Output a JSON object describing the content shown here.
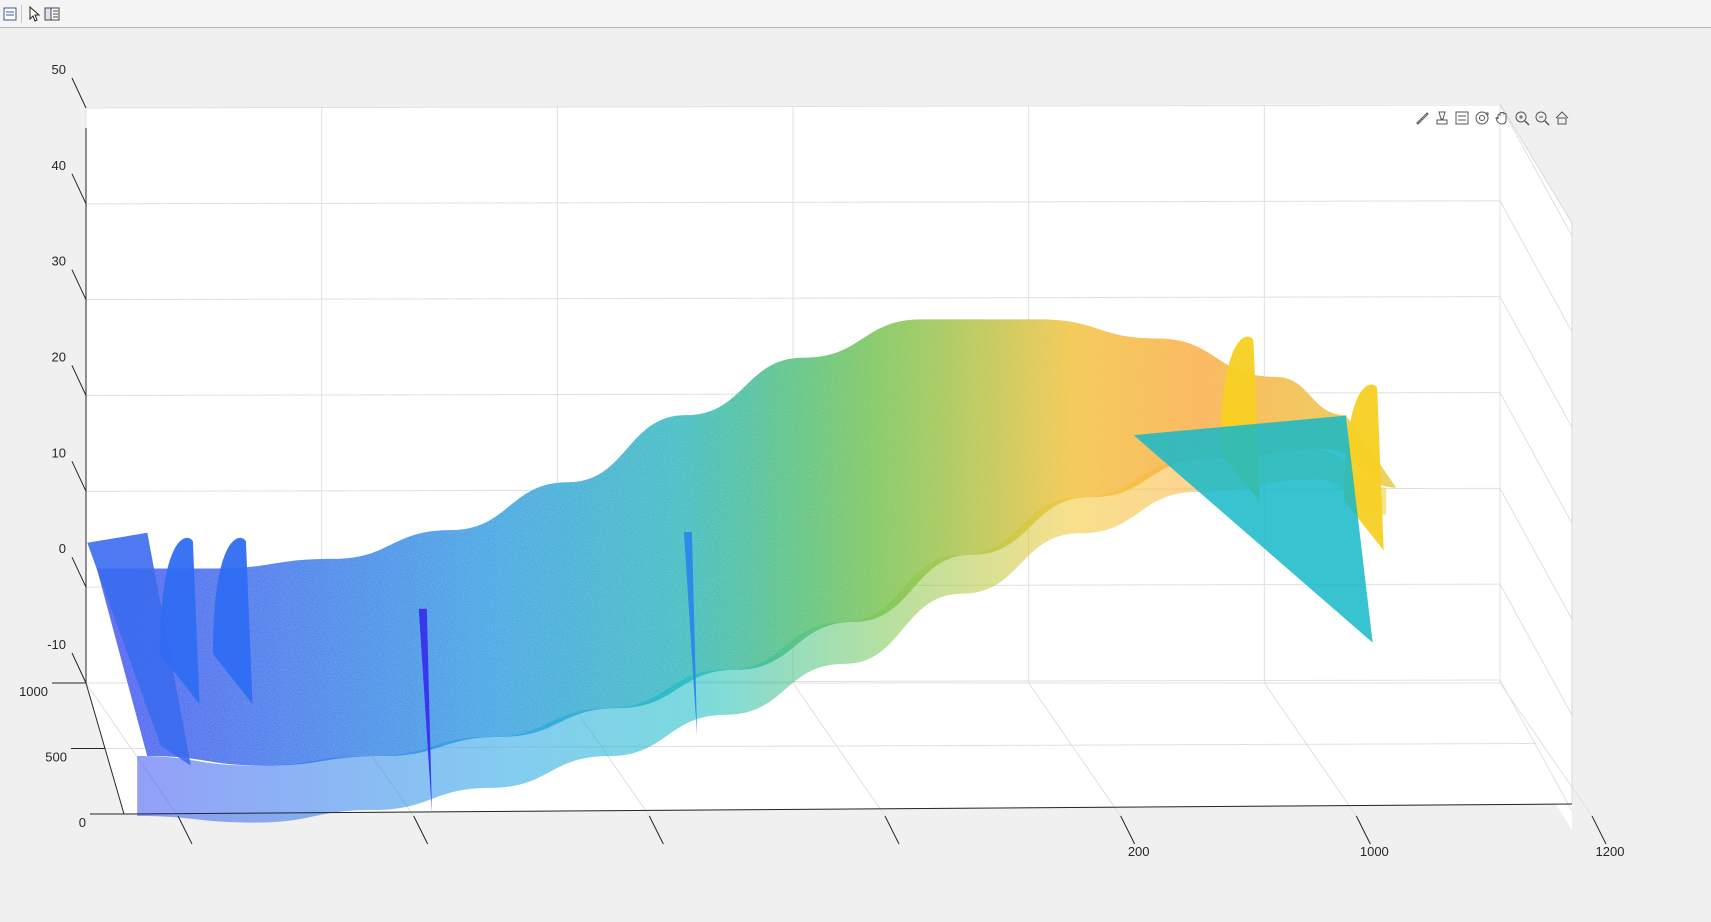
{
  "toolbar": {
    "buttons": [
      {
        "name": "property-inspector-icon"
      },
      {
        "name": "select-arrow-icon"
      },
      {
        "name": "plot-browser-icon"
      }
    ]
  },
  "axes_toolbar": {
    "buttons": [
      {
        "name": "brush-icon"
      },
      {
        "name": "data-tip-icon"
      },
      {
        "name": "legend-icon"
      },
      {
        "name": "rotate-3d-icon"
      },
      {
        "name": "pan-icon"
      },
      {
        "name": "zoom-in-icon"
      },
      {
        "name": "zoom-out-icon"
      },
      {
        "name": "restore-view-icon"
      }
    ]
  },
  "chart_data": {
    "type": "surface",
    "title": "",
    "xlabel": "",
    "ylabel": "",
    "zlabel": "",
    "colormap": "parula",
    "grid": true,
    "z_ticks": [
      "50",
      "40",
      "30",
      "20",
      "10",
      "0",
      "-10"
    ],
    "z_tick_values": [
      50,
      40,
      30,
      20,
      10,
      0,
      -10
    ],
    "zlim": [
      -10,
      50
    ],
    "y_ticks": [
      "1000",
      "500",
      "0"
    ],
    "y_tick_values": [
      1000,
      500,
      0
    ],
    "ylim": [
      0,
      1000
    ],
    "x_ticks": [
      "",
      "",
      "",
      "",
      "200",
      "1000",
      "1200"
    ],
    "x_tick_values": [
      0,
      200,
      400,
      600,
      800,
      1000,
      1200
    ],
    "xlim": [
      0,
      1200
    ],
    "surface_profile": {
      "x": [
        0,
        100,
        200,
        300,
        400,
        500,
        600,
        700,
        800,
        900,
        1000,
        1060
      ],
      "z_front": [
        -6,
        -7,
        -6,
        -4,
        -1,
        3,
        8,
        15,
        21,
        25,
        26,
        22
      ],
      "z_back": [
        4,
        4,
        5,
        8,
        13,
        20,
        26,
        30,
        30,
        28,
        24,
        20
      ]
    },
    "peaks": [
      {
        "x": 60,
        "z": 10
      },
      {
        "x": 105,
        "z": 10
      },
      {
        "x": 960,
        "z": 31
      },
      {
        "x": 1065,
        "z": 26
      }
    ],
    "spikes": [
      {
        "x": 240,
        "z": -12
      },
      {
        "x": 465,
        "z": -4
      }
    ],
    "colors": {
      "low": "#3d3cf0",
      "mid": "#14b6c8",
      "high": "#f7d022",
      "peak": "#fca93a"
    }
  }
}
